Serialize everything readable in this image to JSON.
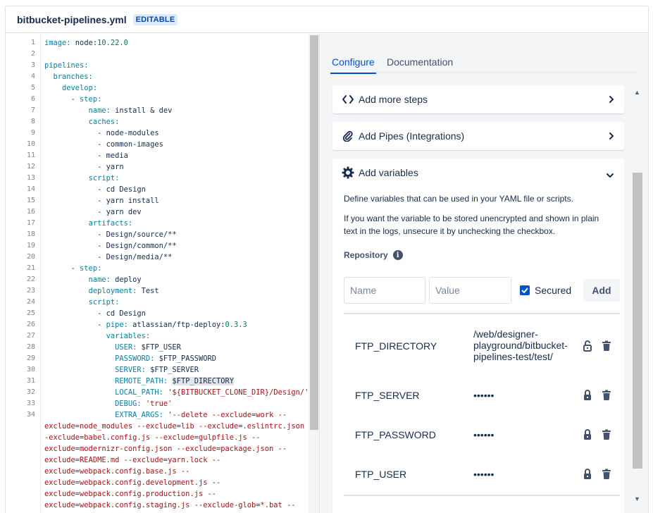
{
  "file": {
    "name": "bitbucket-pipelines.yml",
    "badge": "EDITABLE"
  },
  "editor": {
    "line_numbers": [
      "1",
      "2",
      "3",
      "4",
      "5",
      "6",
      "7",
      "8",
      "9",
      "10",
      "11",
      "12",
      "13",
      "14",
      "15",
      "16",
      "17",
      "18",
      "19",
      "20",
      "21",
      "22",
      "23",
      "24",
      "25",
      "26",
      "27",
      "28",
      "29",
      "30",
      "31",
      "32",
      "33",
      "34"
    ],
    "wrapped_lines": [
      "exclude=node_modules --exclude=lib --exclude=.eslintrc.json -",
      "-exclude=babel.config.js --exclude=gulpfile.js --",
      "exclude=modernizr-config.json --exclude=package.json --",
      "exclude=README.md --exclude=yarn.lock --",
      "exclude=webpack.config.base.js --",
      "exclude=webpack.config.development.js --",
      "exclude=webpack.config.production.js --",
      "exclude=webpack.config.staging.js --exclude-glob=*.bat --"
    ]
  },
  "tabs": [
    {
      "label": "Configure"
    },
    {
      "label": "Documentation"
    }
  ],
  "cards": {
    "steps": {
      "label": "Add more steps",
      "icon": "code-icon"
    },
    "pipes": {
      "label": "Add Pipes (Integrations)",
      "icon": "paperclip-icon"
    },
    "variables": {
      "label": "Add variables",
      "icon": "gear-icon",
      "description1": "Define variables that can be used in your YAML file or scripts.",
      "description2": "If you want the variable to be stored unencrypted and shown in plain text in the logs, unsecure it by unchecking the checkbox.",
      "repository_label": "Repository",
      "name_placeholder": "Name",
      "value_placeholder": "Value",
      "secured_label": "Secured",
      "add_label": "Add",
      "variables": [
        {
          "name": "FTP_DIRECTORY",
          "value": "/web/designer-playground/bitbucket-pipelines-test/test/",
          "secured": false
        },
        {
          "name": "FTP_SERVER",
          "value": "••••••",
          "secured": true
        },
        {
          "name": "FTP_PASSWORD",
          "value": "••••••",
          "secured": true
        },
        {
          "name": "FTP_USER",
          "value": "••••••",
          "secured": true
        }
      ]
    }
  },
  "colors": {
    "accent": "#0052cc",
    "badge_bg": "#deebff",
    "panel_bg": "#f4f5f7"
  }
}
